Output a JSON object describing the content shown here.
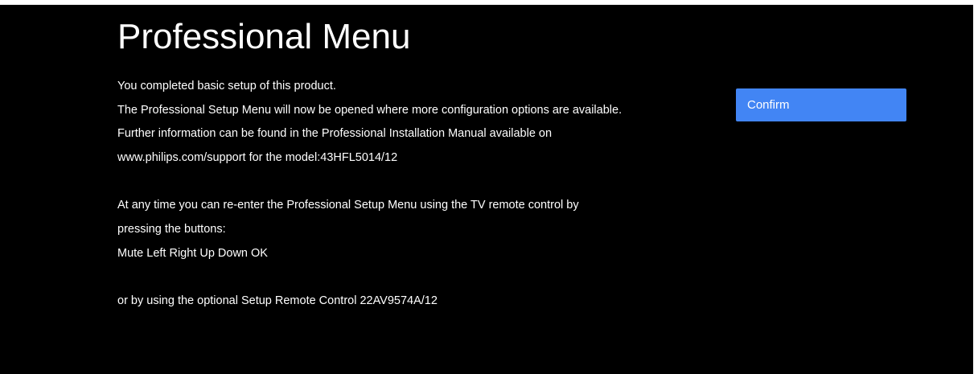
{
  "menu": {
    "title": "Professional Menu",
    "lines": [
      "You completed basic setup of this product.",
      "The Professional Setup Menu will now be opened where more configuration options are available.",
      "Further information can be found in the Professional Installation Manual available on",
      "www.philips.com/support for the model:43HFL5014/12",
      "At any time you can re-enter the Professional Setup Menu using the TV remote control by",
      "pressing the buttons:",
      "Mute Left Right Up Down OK",
      "or by using the optional Setup Remote Control 22AV9574A/12"
    ],
    "confirm_label": "Confirm"
  },
  "colors": {
    "background": "#000000",
    "text": "#ffffff",
    "accent": "#4285f4"
  }
}
